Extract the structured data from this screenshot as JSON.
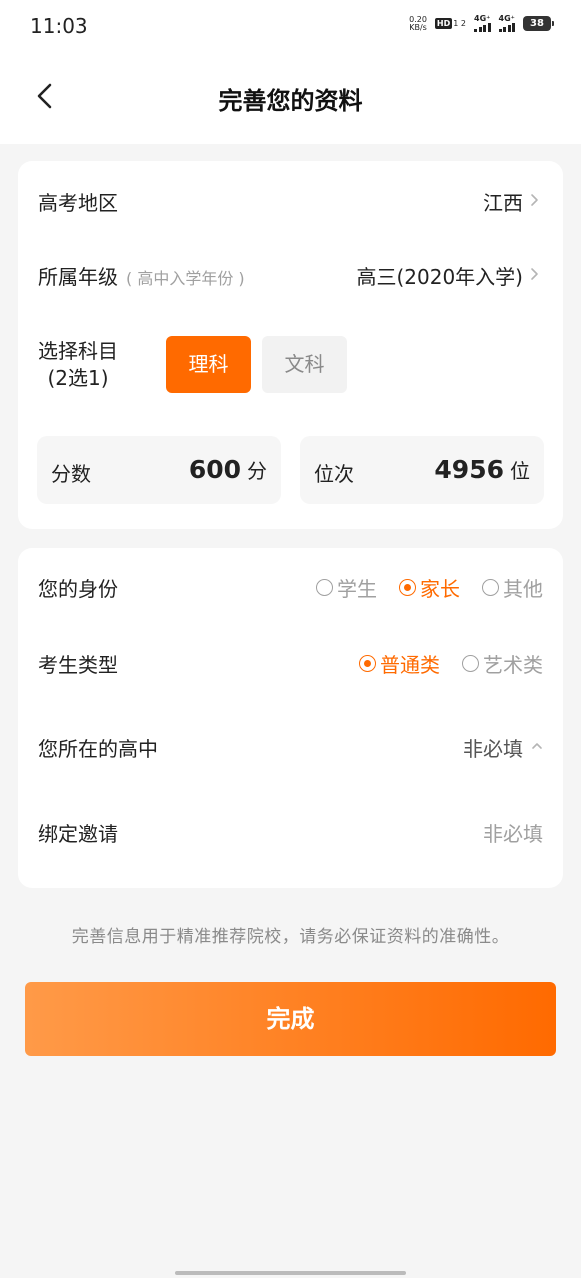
{
  "status_bar": {
    "time": "11:03",
    "net_speed_value": "0.20",
    "net_speed_unit": "KB/s",
    "hd_label": "HD",
    "hd_sub": "1 2",
    "signal1_label": "4G⁺",
    "signal2_label": "4G⁺",
    "battery": "38"
  },
  "header": {
    "title": "完善您的资料",
    "back_icon": "chevron-left-icon"
  },
  "profile": {
    "region": {
      "label": "高考地区",
      "value": "江西"
    },
    "grade": {
      "label": "所属年级",
      "hint": "( 高中入学年份 )",
      "value": "高三(2020年入学)"
    },
    "subject": {
      "label_line1": "选择科目",
      "label_line2": "(2选1)",
      "options": [
        "理科",
        "文科"
      ],
      "selected": "理科"
    },
    "score": {
      "label": "分数",
      "value": "600",
      "unit": "分"
    },
    "rank": {
      "label": "位次",
      "value": "4956",
      "unit": "位"
    }
  },
  "identity": {
    "role": {
      "label": "您的身份",
      "options": [
        "学生",
        "家长",
        "其他"
      ],
      "selected": "家长"
    },
    "exam_type": {
      "label": "考生类型",
      "options": [
        "普通类",
        "艺术类"
      ],
      "selected": "普通类"
    },
    "school": {
      "label": "您所在的高中",
      "value": "非必填"
    },
    "invite": {
      "label": "绑定邀请",
      "placeholder": "非必填"
    }
  },
  "notice": "完善信息用于精准推荐院校，请务必保证资料的准确性。",
  "submit_label": "完成",
  "colors": {
    "accent": "#ff6a00",
    "accent_light": "#ff9a48",
    "background": "#f5f5f5",
    "muted_text": "#a0a0a0"
  }
}
